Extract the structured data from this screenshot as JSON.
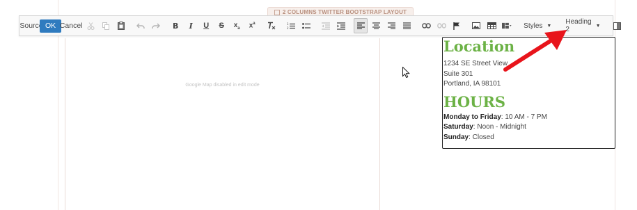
{
  "layout_tag": {
    "label": "2 COLUMNS TWITTER BOOTSTRAP LAYOUT"
  },
  "toolbar": {
    "source_label": "Source",
    "ok_label": "OK",
    "cancel_label": "Cancel",
    "styles_label": "Styles",
    "format_label": "Heading 2"
  },
  "map": {
    "placeholder": "Google Map disabled in edit mode"
  },
  "content": {
    "location_heading": "Location",
    "address_lines": [
      "1234 SE Street View",
      "Suite 301",
      "Portland, IA 98101"
    ],
    "hours_heading": "HOURS",
    "hours": [
      {
        "day": "Monday to Friday",
        "time": ": 10 AM - 7 PM"
      },
      {
        "day": "Saturday",
        "time": ": Noon - Midnight"
      },
      {
        "day": "Sunday",
        "time": ": Closed"
      }
    ]
  },
  "colors": {
    "heading_green": "#6cb246",
    "ok_blue": "#2f7bbf",
    "annotation_red": "#e8141b"
  },
  "icons": [
    "source-icon",
    "cut-icon",
    "copy-icon",
    "paste-icon",
    "undo-icon",
    "redo-icon",
    "bold-icon",
    "italic-icon",
    "underline-icon",
    "strikethrough-icon",
    "subscript-icon",
    "superscript-icon",
    "remove-format-icon",
    "numbered-list-icon",
    "bulleted-list-icon",
    "decrease-indent-icon",
    "increase-indent-icon",
    "align-left-icon",
    "align-center-icon",
    "align-right-icon",
    "justify-icon",
    "link-icon",
    "unlink-icon",
    "anchor-icon",
    "image-icon",
    "table-icon",
    "layout-icon",
    "maximize-icon"
  ]
}
